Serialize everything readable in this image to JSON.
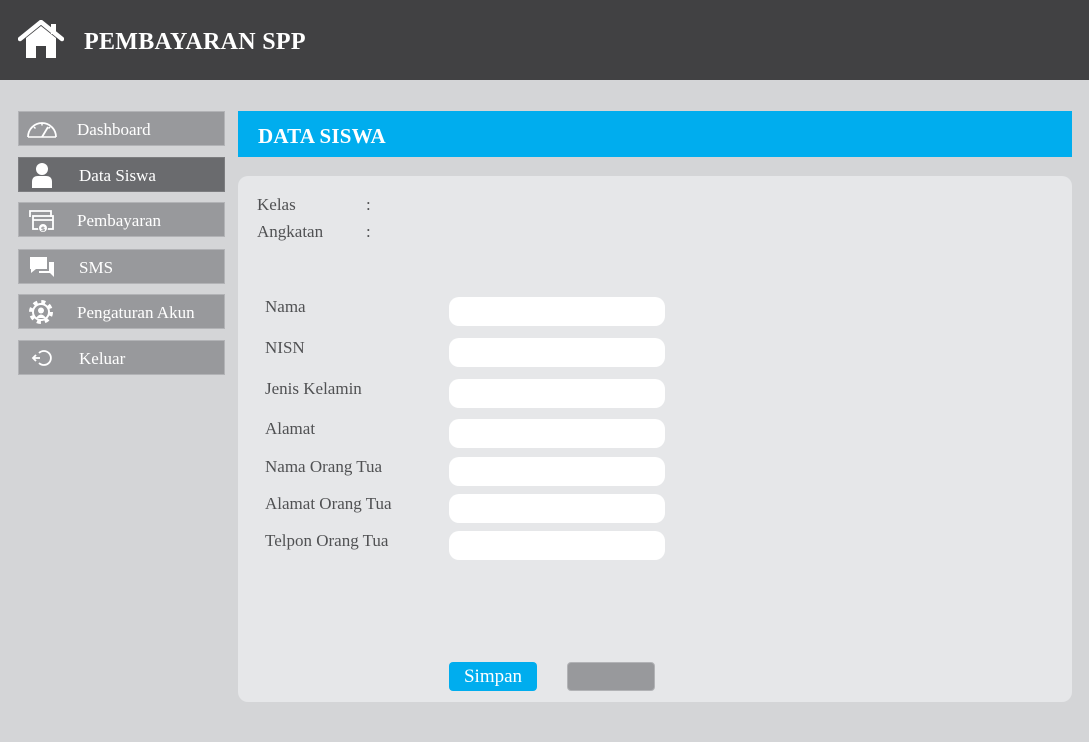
{
  "header": {
    "title": "PEMBAYARAN SPP",
    "icon": "home-icon"
  },
  "sidebar": {
    "items": [
      {
        "label": "Dashboard",
        "icon": "speedometer-icon"
      },
      {
        "label": "Data Siswa",
        "icon": "user-icon",
        "active": true
      },
      {
        "label": "Pembayaran",
        "icon": "payment-card-icon"
      },
      {
        "label": "SMS",
        "icon": "chat-icon"
      },
      {
        "label": "Pengaturan Akun",
        "icon": "gear-icon"
      },
      {
        "label": "Keluar",
        "icon": "logout-icon"
      }
    ]
  },
  "main": {
    "title": "DATA SISWA",
    "info": {
      "kelas_label": "Kelas",
      "angkatan_label": "Angkatan",
      "colon": ":"
    },
    "form": {
      "fields": [
        {
          "label": "Nama",
          "value": ""
        },
        {
          "label": "NISN",
          "value": ""
        },
        {
          "label": "Jenis Kelamin",
          "value": ""
        },
        {
          "label": "Alamat",
          "value": ""
        },
        {
          "label": "Nama Orang Tua",
          "value": ""
        },
        {
          "label": "Alamat Orang Tua",
          "value": ""
        },
        {
          "label": "Telpon Orang Tua",
          "value": ""
        }
      ],
      "save_label": "Simpan",
      "second_button_label": ""
    }
  },
  "colors": {
    "topbar": "#414143",
    "accent": "#00adee",
    "nav": "#98999c",
    "nav_active": "#6a6b6e",
    "panel": "#e6e7e9"
  }
}
